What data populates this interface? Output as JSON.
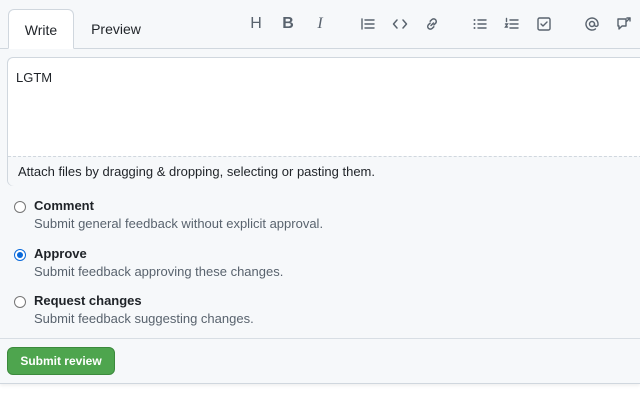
{
  "tabs": {
    "write": "Write",
    "preview": "Preview"
  },
  "toolbar": {
    "heading": "H",
    "bold": "B",
    "italic": "I",
    "icons": [
      "heading-icon",
      "bold-icon",
      "italic-icon",
      "quote-icon",
      "code-icon",
      "link-icon",
      "unordered-list-icon",
      "ordered-list-icon",
      "task-list-icon",
      "mention-icon",
      "reference-icon"
    ]
  },
  "editor": {
    "value": "LGTM",
    "attach_hint": "Attach files by dragging & dropping, selecting or pasting them."
  },
  "review_options": [
    {
      "title": "Comment",
      "description": "Submit general feedback without explicit approval.",
      "checked": false
    },
    {
      "title": "Approve",
      "description": "Submit feedback approving these changes.",
      "checked": true
    },
    {
      "title": "Request changes",
      "description": "Submit feedback suggesting changes.",
      "checked": false
    }
  ],
  "submit_label": "Submit review",
  "colors": {
    "accent": "#0969da",
    "submit": "#4ea54e"
  }
}
